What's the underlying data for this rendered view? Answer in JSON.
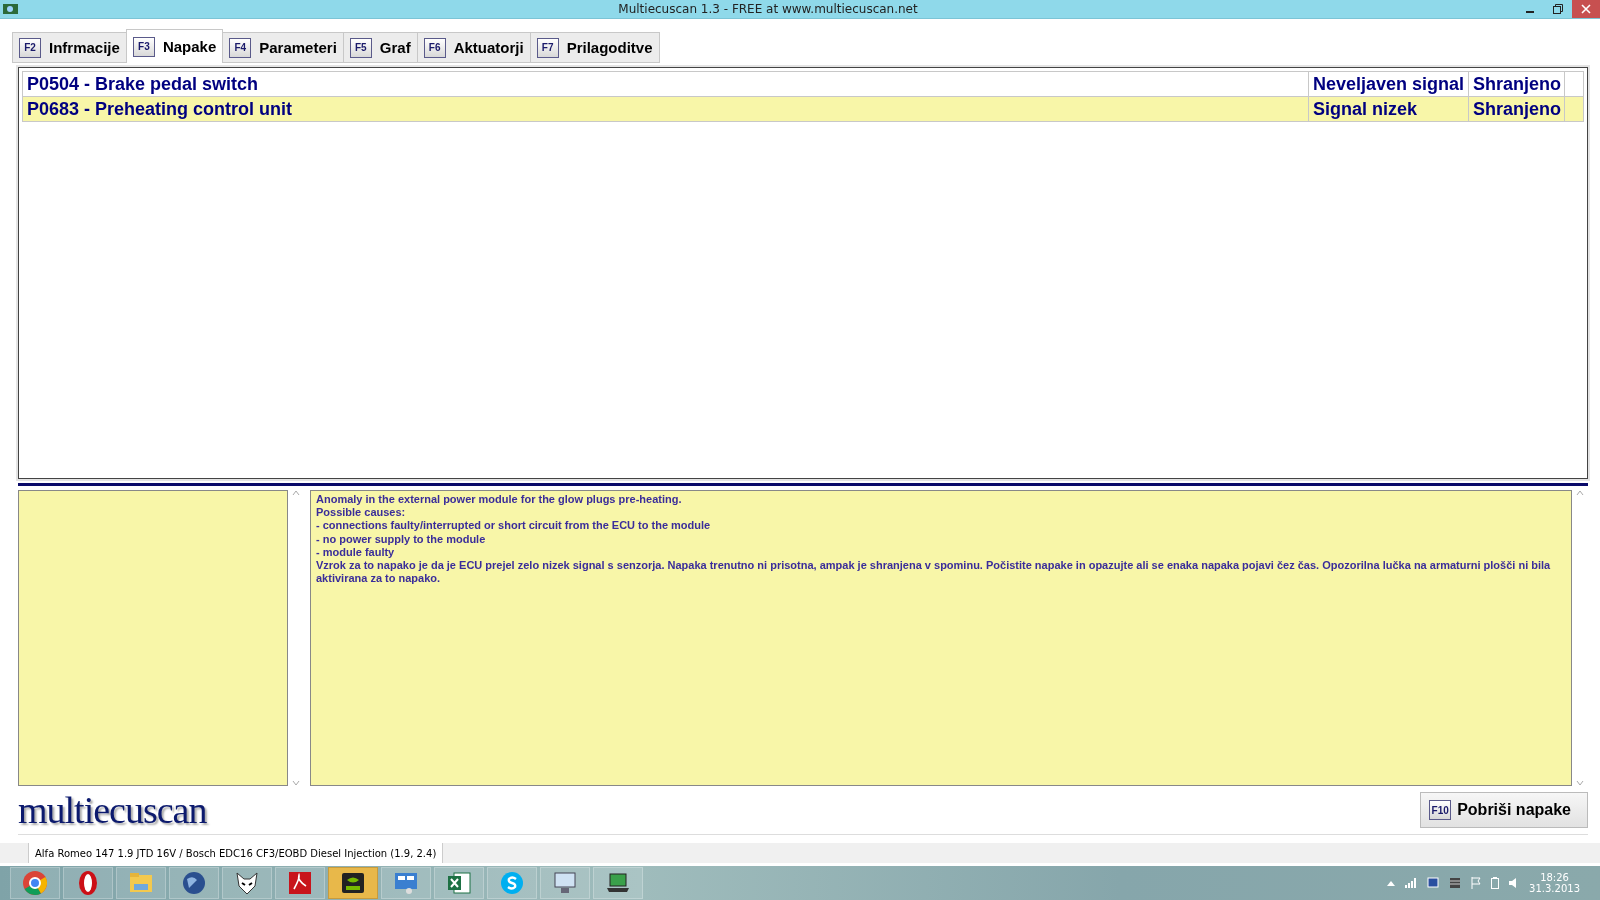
{
  "window": {
    "title": "Multiecuscan 1.3 - FREE at www.multiecuscan.net"
  },
  "tabs": [
    {
      "key": "F2",
      "label": "Infrmacije",
      "selected": false
    },
    {
      "key": "F3",
      "label": "Napake",
      "selected": true
    },
    {
      "key": "F4",
      "label": "Parameteri",
      "selected": false
    },
    {
      "key": "F5",
      "label": "Graf",
      "selected": false
    },
    {
      "key": "F6",
      "label": "Aktuatorji",
      "selected": false
    },
    {
      "key": "F7",
      "label": "Prilagoditve",
      "selected": false
    }
  ],
  "faults": {
    "rows": [
      {
        "code": "P0504 - Brake pedal switch",
        "type": "Neveljaven signal",
        "status": "Shranjeno",
        "selected": false
      },
      {
        "code": "P0683 - Preheating control unit",
        "type": "Signal nizek",
        "status": "Shranjeno",
        "selected": true
      }
    ]
  },
  "description": {
    "lines": [
      "Anomaly in the external power module for the glow plugs pre-heating.",
      "Possible causes:",
      "- connections faulty/interrupted or short circuit from the ECU to the module",
      "- no power supply to the module",
      "- module faulty",
      "Vzrok za to napako je da je ECU prejel zelo nizek signal s senzorja. Napaka trenutno ni prisotna, ampak je shranjena v spominu. Počistite napake in opazujte ali se enaka napaka pojavi čez čas. Opozorilna lučka na armaturni plošči ni bila aktivirana za to napako."
    ]
  },
  "logo": "multiecuscan",
  "clear_button": {
    "key": "F10",
    "label": "Pobriši napake"
  },
  "status_bar": {
    "vehicle": "Alfa Romeo 147 1.9 JTD 16V / Bosch EDC16 CF3/EOBD Diesel Injection (1.9, 2.4)"
  },
  "taskbar": {
    "apps": [
      {
        "kind": "chrome",
        "active": false
      },
      {
        "kind": "opera",
        "active": false
      },
      {
        "kind": "folder",
        "active": false
      },
      {
        "kind": "globe",
        "active": false
      },
      {
        "kind": "mask",
        "active": false
      },
      {
        "kind": "pdf",
        "active": false
      },
      {
        "kind": "gpu",
        "active": true
      },
      {
        "kind": "panel",
        "active": false
      },
      {
        "kind": "sheet",
        "active": false
      },
      {
        "kind": "chat",
        "active": false
      },
      {
        "kind": "monitor",
        "active": false
      },
      {
        "kind": "laptop",
        "active": false
      }
    ],
    "clock": {
      "time": "18:26",
      "date": "31.3.2013"
    }
  }
}
